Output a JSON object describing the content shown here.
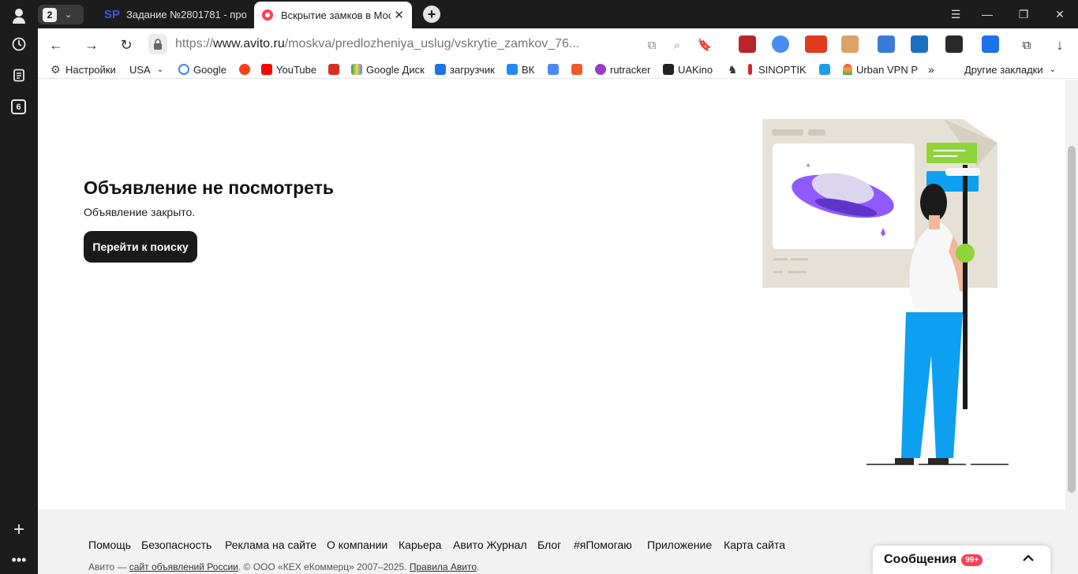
{
  "browser": {
    "profile_tab_count": "2",
    "sidebar_badge": "6",
    "tabs": [
      {
        "label": "Задание №2801781 - про",
        "icon": "SP"
      },
      {
        "label": "Вскрытие замков в Мос",
        "icon": "avito-dot"
      }
    ],
    "url_prefix": "https://",
    "url_host": "www.avito.ru",
    "url_path": "/moskva/predlozheniya_uslug/vskrytie_zamkov_76..."
  },
  "bookmarks": [
    {
      "label": "Настройки",
      "icon": "gear-icon",
      "color": "#444444"
    },
    {
      "label": "USA",
      "icon": "dropdown",
      "color": "#444444"
    },
    {
      "label": "Google",
      "icon": "google-icon",
      "color": "#4285f4"
    },
    {
      "label": "",
      "icon": "yandex-icon",
      "color": "#fc3f1d"
    },
    {
      "label": "YouTube",
      "icon": "youtube-icon",
      "color": "#ff0000"
    },
    {
      "label": "",
      "icon": "gmail-icon",
      "color": "#d93025"
    },
    {
      "label": "Google Диск",
      "icon": "drive-icon",
      "color": "#1fa463"
    },
    {
      "label": "загрузчик",
      "icon": "loop-icon",
      "color": "#1a73e8"
    },
    {
      "label": "ВК",
      "icon": "vk-icon",
      "color": "#2787f5"
    },
    {
      "label": "",
      "icon": "translate-icon",
      "color": "#4a8af4"
    },
    {
      "label": "",
      "icon": "f-icon",
      "color": "#ef5a2b"
    },
    {
      "label": "rutracker",
      "icon": "rutracker-icon",
      "color": "#9b3cc5"
    },
    {
      "label": "UAKino",
      "icon": "uakino-icon",
      "color": "#222222"
    },
    {
      "label": "",
      "icon": "chess-icon",
      "color": "#333333"
    },
    {
      "label": "SINOPTIK",
      "icon": "thermometer-icon",
      "color": "#d12a2a"
    },
    {
      "label": "",
      "icon": "p-icon",
      "color": "#1a9ee8"
    },
    {
      "label": "Urban VPN P",
      "icon": "rainbow-icon",
      "color": "#f2a33a"
    }
  ],
  "bookmarks_other": "Другие закладки",
  "page": {
    "heading": "Объявление не посмотреть",
    "subtext": "Объявление закрыто.",
    "button": "Перейти к поиску"
  },
  "footer": {
    "links": [
      "Помощь",
      "Безопасность",
      "Реклама на сайте",
      "О компании",
      "Карьера",
      "Авито Журнал",
      "Блог",
      "#яПомогаю",
      "Приложение",
      "Карта сайта"
    ],
    "copyright_a": "Авито — ",
    "copyright_link": "сайт объявлений России",
    "copyright_b": ". © ООО «КЕХ eКоммерц» 2007–2025. ",
    "copyright_rules": "Правила Авито",
    "copyright_end": "."
  },
  "messages": {
    "label": "Сообщения",
    "badge": "99+"
  },
  "colors": {
    "accent_purple": "#8f5bff",
    "accent_blue": "#0ea0f0",
    "accent_green": "#8fd43a"
  }
}
